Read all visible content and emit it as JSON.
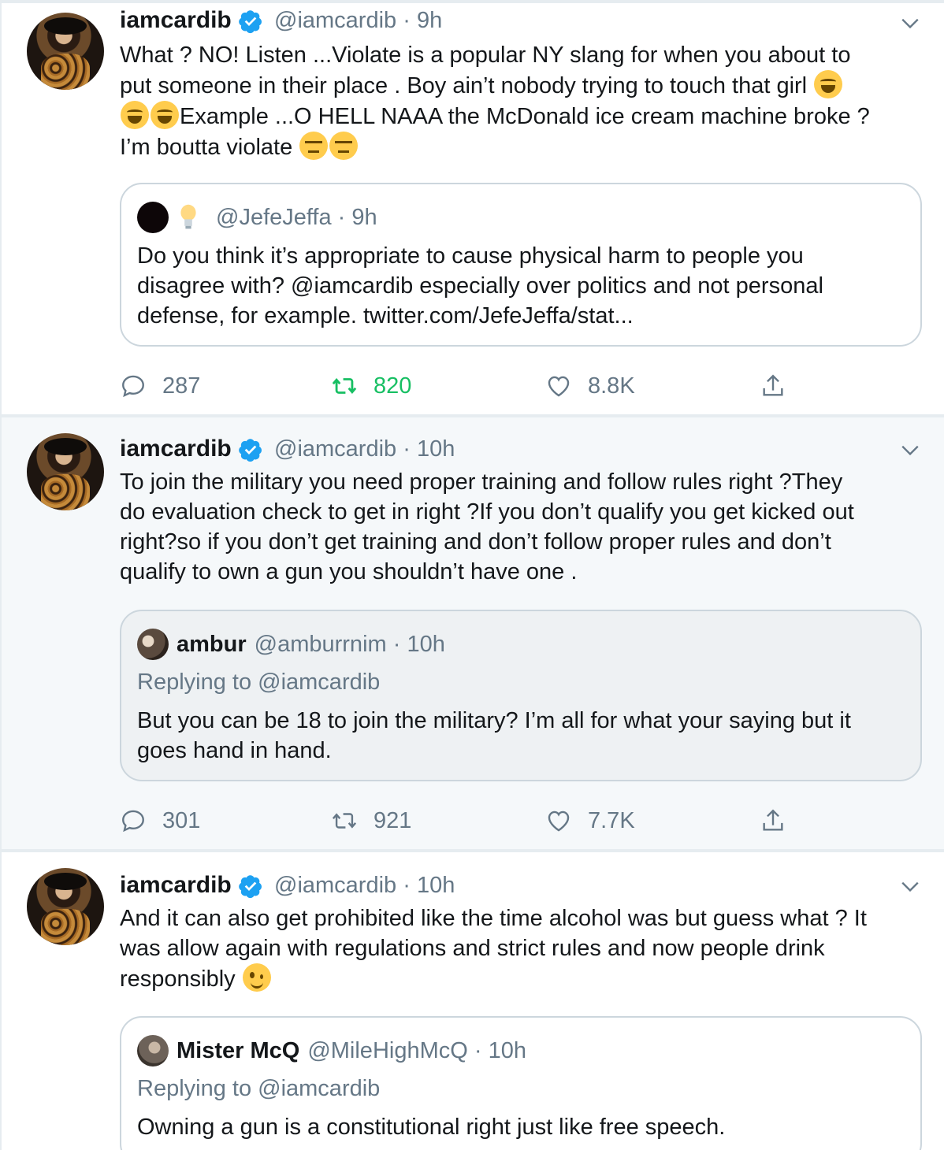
{
  "colors": {
    "link": "#1da1f2",
    "retweet_active": "#17bf63",
    "muted": "#657786",
    "verified": "#1da1f2"
  },
  "tweets": [
    {
      "name": "iamcardib",
      "handle": "@iamcardib",
      "time": "9h",
      "text_lines": [
        "What ? NO! Listen ...Violate is a popular NY slang for when you about to",
        "put someone in their place . Boy ain’t nobody trying to touch that girl",
        "Example ...O HELL NAAA the McDonald ice cream machine broke ?",
        "I’m boutta violate"
      ],
      "emojis": [
        "tears-of-joy-emoji",
        "tears-of-joy-emoji",
        "tears-of-joy-emoji",
        "unamused-emoji",
        "unamused-emoji"
      ],
      "quote": {
        "name": "",
        "handle": "@JefeJeffa",
        "time": "9h",
        "name_emoji": "light-bulb-emoji",
        "replying_to": "",
        "text_lines": [
          "Do you think it’s appropriate to cause physical harm to people you",
          "disagree with? @iamcardib especially over politics and not personal",
          "defense, for example. twitter.com/JefeJeffa/stat..."
        ]
      },
      "replies": "287",
      "retweets": "820",
      "retweeted": true,
      "likes": "8.8K"
    },
    {
      "name": "iamcardib",
      "handle": "@iamcardib",
      "time": "10h",
      "text_lines": [
        "To join the military you need proper training and follow rules right ?They",
        "do evaluation check to get in right ?If you don’t qualify you get kicked out",
        "right?so if you don’t get training and don’t follow proper rules and don’t",
        "qualify to own a gun you shouldn’t have one ."
      ],
      "quote": {
        "name": "ambur",
        "handle": "@amburrnim",
        "time": "10h",
        "replying_to": "Replying to @iamcardib",
        "text_lines": [
          "But you can be 18 to join the military? I’m all for what your saying but it",
          "goes hand in hand."
        ]
      },
      "replies": "301",
      "retweets": "921",
      "retweeted": false,
      "likes": "7.7K"
    },
    {
      "name": "iamcardib",
      "handle": "@iamcardib",
      "time": "10h",
      "text_lines": [
        "And it can also get prohibited like the time alcohol was but guess what ? It",
        "was allow again with regulations and strict rules and now people drink",
        "responsibly"
      ],
      "emojis": [
        "winking-face-emoji"
      ],
      "quote": {
        "name": "Mister McQ",
        "handle": "@MileHighMcQ",
        "time": "10h",
        "replying_to": "Replying to @iamcardib",
        "text_lines": [
          "Owning a gun is a constitutional right just like free speech."
        ]
      }
    }
  ]
}
